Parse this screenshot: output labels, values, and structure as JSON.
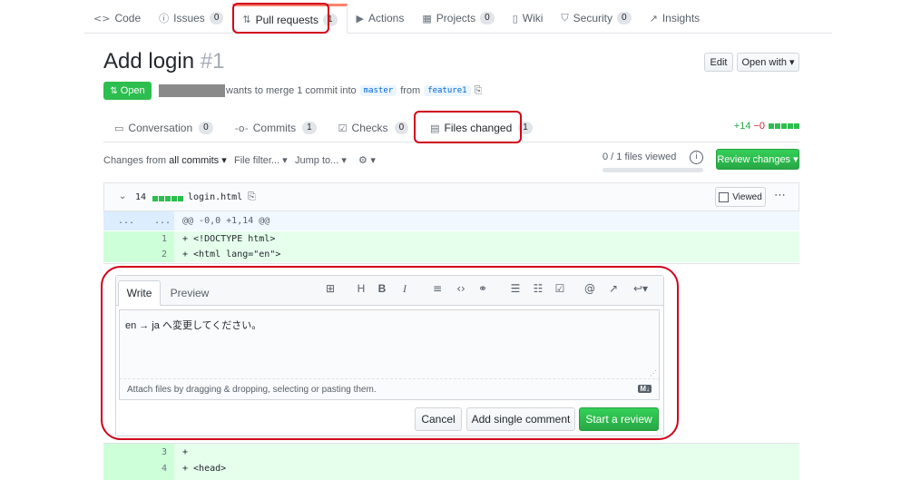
{
  "repo_nav": {
    "tabs": [
      {
        "icon": "code-icon",
        "glyph": "<>",
        "label": "Code"
      },
      {
        "icon": "issue-icon",
        "glyph": "ⓘ",
        "label": "Issues",
        "count": "0"
      },
      {
        "icon": "pull-request-icon",
        "glyph": "⇅",
        "label": "Pull requests",
        "count": "1"
      },
      {
        "icon": "actions-icon",
        "glyph": "▶",
        "label": "Actions"
      },
      {
        "icon": "projects-icon",
        "glyph": "▦",
        "label": "Projects",
        "count": "0"
      },
      {
        "icon": "wiki-icon",
        "glyph": "▯",
        "label": "Wiki"
      },
      {
        "icon": "security-icon",
        "glyph": "⛉",
        "label": "Security",
        "count": "0"
      },
      {
        "icon": "insights-icon",
        "glyph": "↗",
        "label": "Insights"
      }
    ]
  },
  "pr": {
    "title": "Add login",
    "number": "#1",
    "state": "Open",
    "merge_text": "wants to merge 1 commit into",
    "base_branch": "master",
    "from_text": "from",
    "head_branch": "feature1",
    "edit_label": "Edit",
    "open_with_label": "Open with ▾"
  },
  "pr_tabs": [
    {
      "glyph": "▭",
      "label": "Conversation",
      "count": "0"
    },
    {
      "glyph": "-o-",
      "label": "Commits",
      "count": "1"
    },
    {
      "glyph": "☑",
      "label": "Checks",
      "count": "0"
    },
    {
      "glyph": "▤",
      "label": "Files changed",
      "count": "1"
    }
  ],
  "diffstat": {
    "additions": "+14",
    "deletions": "−0"
  },
  "toolbar": {
    "changes_prefix": "Changes from",
    "changes_value": "all commits ▾",
    "file_filter": "File filter... ▾",
    "jump_to": "Jump to... ▾",
    "settings": "⚙ ▾",
    "files_viewed": "0 / 1 files viewed",
    "files_viewed_fraction": 0,
    "review_changes": "Review changes ▾"
  },
  "file": {
    "changes": "14",
    "name": "login.html",
    "viewed_label": "Viewed",
    "hunk_left": "...",
    "hunk_right": "...",
    "hunk_header": "@@ -0,0 +1,14 @@",
    "lines": [
      {
        "num": "1",
        "code": "+ <!DOCTYPE html>"
      },
      {
        "num": "2",
        "code": "+ <html lang=\"en\">"
      },
      {
        "num": "3",
        "code": "+"
      },
      {
        "num": "4",
        "code": "+ <head>"
      }
    ]
  },
  "comment": {
    "write_tab": "Write",
    "preview_tab": "Preview",
    "text": "en → ja へ変更してください。",
    "attach_hint": "Attach files by dragging & dropping, selecting or pasting them.",
    "markdown_badge": "M↓",
    "cancel": "Cancel",
    "add_single": "Add single comment",
    "start_review": "Start a review"
  }
}
